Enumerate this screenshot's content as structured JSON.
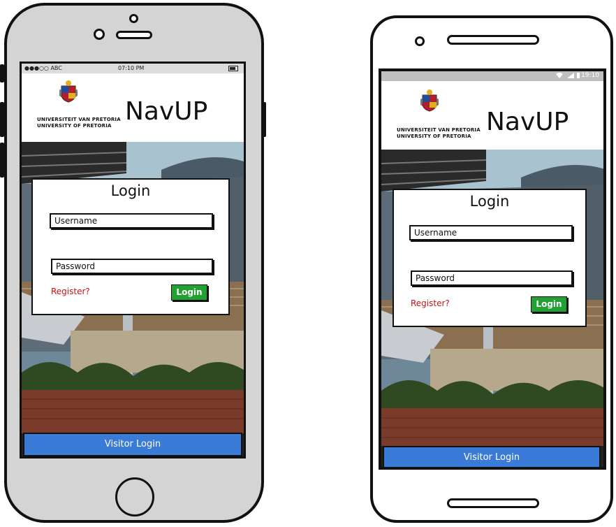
{
  "colors": {
    "accent_green": "#22a032",
    "visitor_blue": "#3b7bd8",
    "register_red": "#c81414"
  },
  "ios_status": {
    "carrier": "●●●○○ ABC",
    "time": "07:10 PM",
    "battery_icon": "battery-icon"
  },
  "android_status": {
    "time": "19:10"
  },
  "header": {
    "university_line1": "UNIVERSITEIT VAN PRETORIA",
    "university_line2": "UNIVERSITY OF PRETORIA",
    "app_title": "NavUP"
  },
  "login_card": {
    "title": "Login",
    "username_placeholder": "Username",
    "password_placeholder": "Password",
    "register_link": "Register?",
    "login_button": "Login"
  },
  "visitor_button": "Visitor Login"
}
